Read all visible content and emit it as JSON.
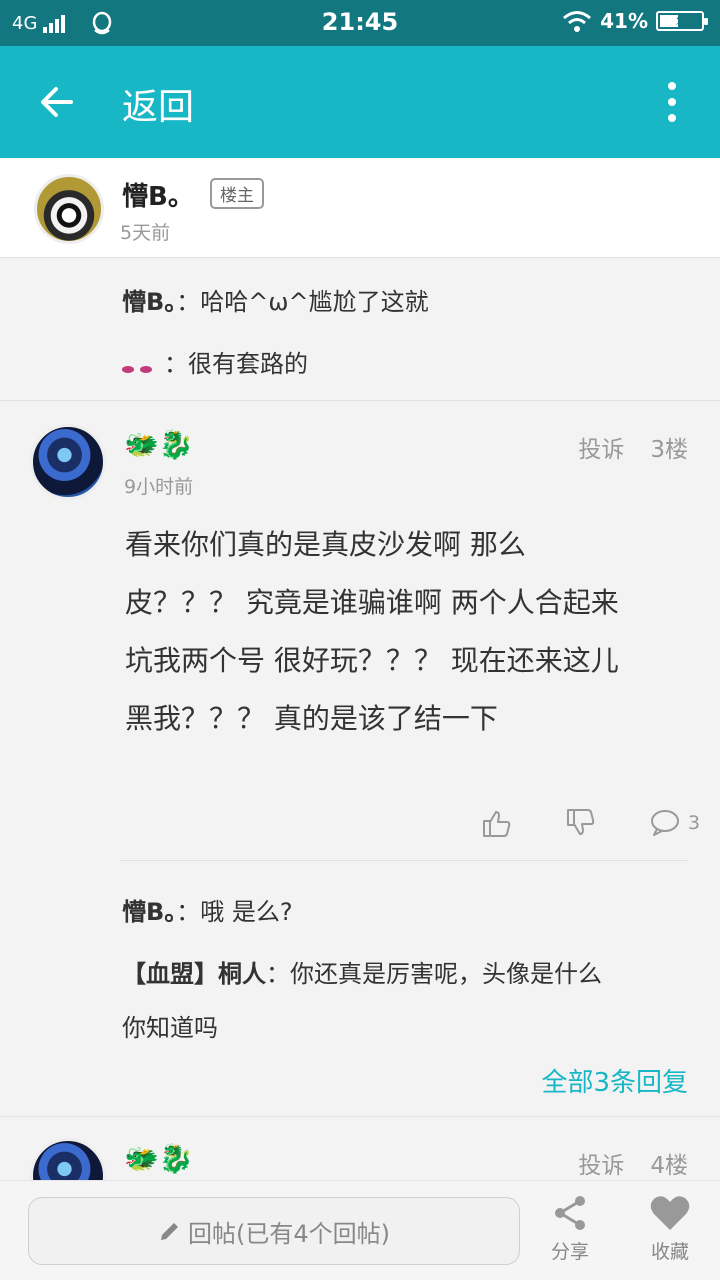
{
  "status": {
    "network": "4G",
    "time": "21:45",
    "battery": "41%"
  },
  "header": {
    "back_icon": "arrow-left-icon",
    "title": "返回",
    "more_icon": "more-vert-icon"
  },
  "op": {
    "name": "懵B。",
    "badge": "楼主",
    "time": "5天前"
  },
  "op_replies": [
    {
      "user": "懵B。",
      "text": "哈哈^ω^尴尬了这就"
    },
    {
      "user_icon": "eyes-emoji-icon",
      "text": "很有套路的"
    }
  ],
  "post3": {
    "name": "🐲🐉",
    "time": "9小时前",
    "report": "投诉",
    "floor": "3楼",
    "body": [
      "看来你们真的是真皮沙发啊 那么",
      "皮？？？ 究竟是谁骗谁啊 两个人合起来",
      "坑我两个号 很好玩？？？ 现在还来这儿",
      "黑我？？？ 真的是该了结一下"
    ],
    "comment_count": "3",
    "replies": [
      {
        "user": "懵B。",
        "text": "哦 是么?"
      },
      {
        "user": "【血盟】桐人",
        "text_line1": "你还真是厉害呢，头像是什么",
        "text_line2": "你知道吗"
      }
    ],
    "all_replies": "全部3条回复"
  },
  "post4": {
    "name": "🐲🐉",
    "report": "投诉",
    "floor": "4楼"
  },
  "bottom": {
    "reply_placeholder": "回帖(已有4个回帖)",
    "share": "分享",
    "favorite": "收藏"
  },
  "colors": {
    "status_bar": "#12777f",
    "app_bar": "#18b7c6",
    "accent": "#18b7c6"
  }
}
